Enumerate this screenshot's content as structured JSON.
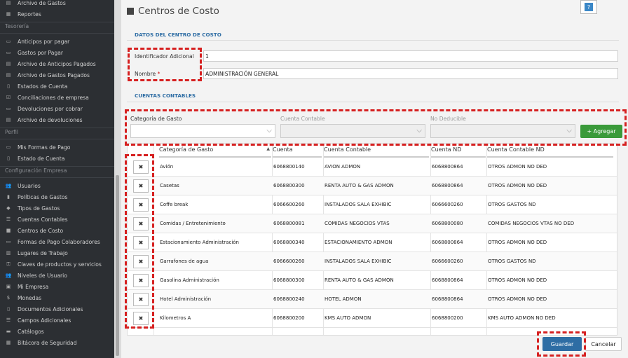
{
  "sidebar": {
    "top_items": [
      {
        "label": "Archivo de Gastos",
        "icon": "archive-icon"
      },
      {
        "label": "Reportes",
        "icon": "table-icon"
      }
    ],
    "sections": [
      {
        "title": "Tesorería",
        "items": [
          {
            "label": "Anticipos por pagar",
            "icon": "money-icon"
          },
          {
            "label": "Gastos por Pagar",
            "icon": "money-icon"
          },
          {
            "label": "Archivo de Anticipos Pagados",
            "icon": "archive-icon"
          },
          {
            "label": "Archivo de Gastos Pagados",
            "icon": "archive-icon"
          },
          {
            "label": "Estados de Cuenta",
            "icon": "document-icon"
          },
          {
            "label": "Conciliaciones de empresa",
            "icon": "check-square-icon"
          },
          {
            "label": "Devoluciones por cobrar",
            "icon": "money-icon"
          },
          {
            "label": "Archivo de devoluciones",
            "icon": "archive-icon"
          }
        ]
      },
      {
        "title": "Perfil",
        "items": [
          {
            "label": "Mis Formas de Pago",
            "icon": "credit-card-icon"
          },
          {
            "label": "Estado de Cuenta",
            "icon": "document-icon"
          }
        ]
      },
      {
        "title": "Configuración Empresa",
        "items": [
          {
            "label": "Usuarios",
            "icon": "users-icon"
          },
          {
            "label": "Políticas de Gastos",
            "icon": "book-icon"
          },
          {
            "label": "Tipos de Gastos",
            "icon": "tag-icon"
          },
          {
            "label": "Cuentas Contables",
            "icon": "list-icon"
          },
          {
            "label": "Centros de Costo",
            "icon": "box-icon"
          },
          {
            "label": "Formas de Pago Colaboradores",
            "icon": "credit-card-icon"
          },
          {
            "label": "Lugares de Trabajo",
            "icon": "building-icon"
          },
          {
            "label": "Claves de productos y servicios",
            "icon": "key-icon"
          },
          {
            "label": "Niveles de Usuario",
            "icon": "users-icon"
          },
          {
            "label": "Mi Empresa",
            "icon": "briefcase-icon"
          },
          {
            "label": "Monedas",
            "icon": "dollar-icon"
          },
          {
            "label": "Documentos Adicionales",
            "icon": "file-icon"
          },
          {
            "label": "Campos Adicionales",
            "icon": "list-icon"
          },
          {
            "label": "Catálogos",
            "icon": "folder-icon"
          },
          {
            "label": "Bitácora de Seguridad",
            "icon": "table-icon"
          }
        ]
      }
    ]
  },
  "page": {
    "title": "Centros de Costo",
    "help_label": "?"
  },
  "datos": {
    "section_title": "DATOS DEL CENTRO DE COSTO",
    "id_label": "Identificador Adicional",
    "id_value": "1",
    "name_label": "Nombre",
    "name_required": "*",
    "name_value": "ADMINISTRACIÓN GENERAL"
  },
  "cuentas": {
    "section_title": "CUENTAS CONTABLES",
    "filter_categoria_label": "Categoría de Gasto",
    "filter_cuenta_label": "Cuenta Contable",
    "filter_nodeducible_label": "No Deducible",
    "add_label": "+ Agregar"
  },
  "table": {
    "headers": [
      "Categoría de Gasto",
      "Cuenta",
      "Cuenta Contable",
      "Cuenta ND",
      "Cuenta Contable ND"
    ],
    "sort_indicator": "▲",
    "delete_symbol": "✖",
    "rows": [
      [
        "Avión",
        "6068800140",
        "AVION ADMON",
        "6068800864",
        "OTROS ADMON NO DED"
      ],
      [
        "Casetas",
        "6068800300",
        "RENTA AUTO & GAS ADMON",
        "6068800864",
        "OTROS ADMON NO DED"
      ],
      [
        "Coffe break",
        "6066600260",
        "INSTALADOS SALA EXHIBIC",
        "6066600260",
        "OTROS GASTOS ND"
      ],
      [
        "Comidas / Entretenimiento",
        "6068800081",
        "COMIDAS NEGOCIOS VTAS",
        "6068800080",
        "COMIDAS NEGOCIOS VTAS NO DED"
      ],
      [
        "Estacionamiento Administración",
        "6068800340",
        "ESTACIONAMIENTO ADMON",
        "6068800864",
        "OTROS ADMON NO DED"
      ],
      [
        "Garrafones de agua",
        "6066600260",
        "INSTALADOS SALA EXHIBIC",
        "6066600260",
        "OTROS GASTOS ND"
      ],
      [
        "Gasolina Administración",
        "6068800300",
        "RENTA AUTO & GAS ADMON",
        "6068800864",
        "OTROS ADMON NO DED"
      ],
      [
        "Hotel Administración",
        "6068800240",
        "HOTEL ADMON",
        "6068800864",
        "OTROS ADMON NO DED"
      ],
      [
        "Kilometros A",
        "6068800200",
        "KMS AUTO ADMON",
        "6068800200",
        "KMS AUTO ADMON NO DED"
      ]
    ]
  },
  "footer": {
    "save_label": "Guardar",
    "cancel_label": "Cancelar"
  },
  "colors": {
    "sidebar_bg": "#2c2f33",
    "accent": "#2e6da4",
    "add_green": "#3a9a3a",
    "highlight": "#d62020"
  }
}
